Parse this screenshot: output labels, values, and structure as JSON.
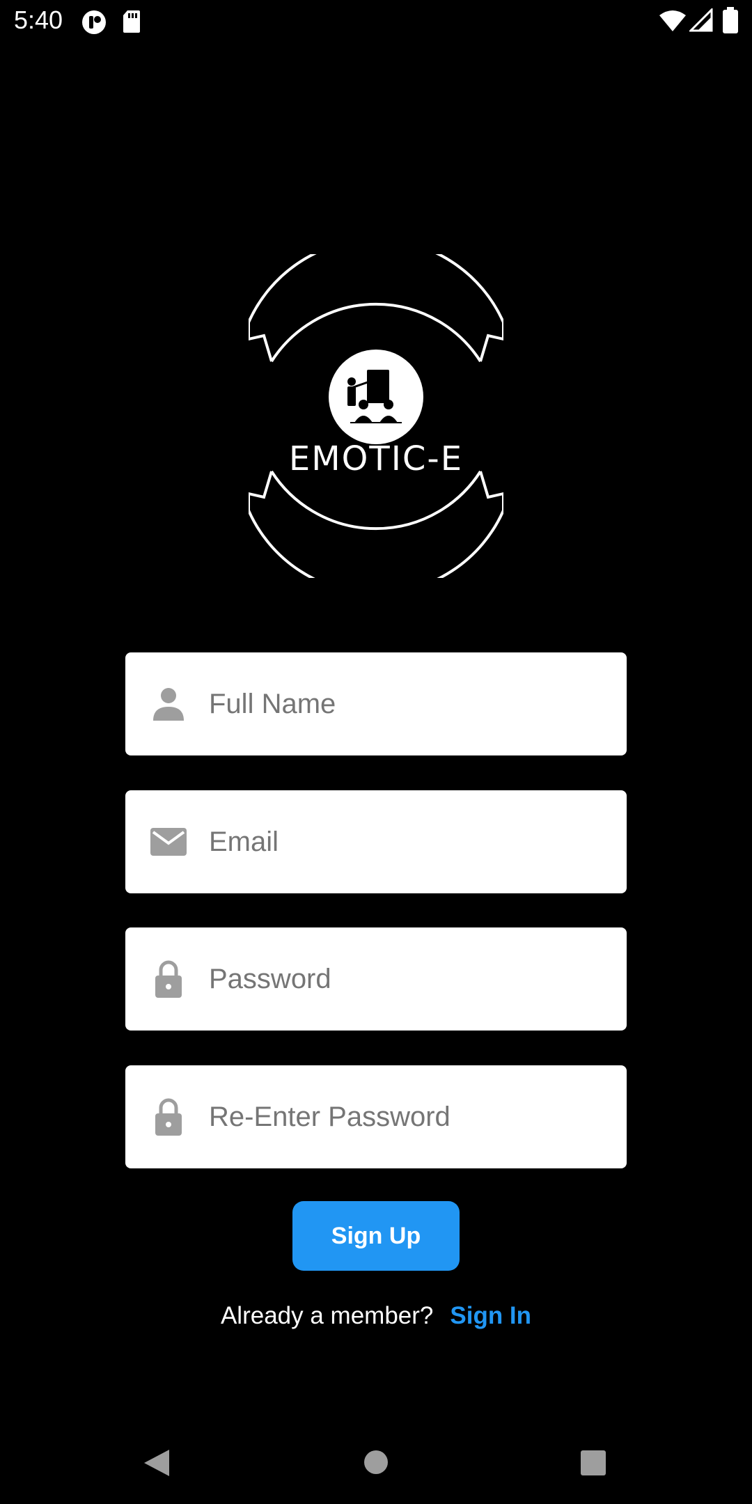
{
  "status_bar": {
    "time": "5:40",
    "icons": [
      "app-notification-icon",
      "sd-card-icon",
      "wifi-icon",
      "cellular-signal-icon",
      "battery-icon"
    ]
  },
  "logo": {
    "text": "EMOTIC-E",
    "icon": "teacher-classroom-icon"
  },
  "form": {
    "full_name": {
      "placeholder": "Full Name",
      "value": "",
      "icon": "person-icon"
    },
    "email": {
      "placeholder": "Email",
      "value": "",
      "icon": "mail-icon"
    },
    "password": {
      "placeholder": "Password",
      "value": "",
      "icon": "lock-icon"
    },
    "re_password": {
      "placeholder": "Re-Enter Password",
      "value": "",
      "icon": "lock-icon"
    }
  },
  "signup_button": {
    "label": "Sign Up"
  },
  "signin": {
    "prompt": "Already a member?",
    "link": "Sign In"
  },
  "nav_bar": {
    "buttons": [
      "back-icon",
      "home-icon",
      "recents-icon"
    ]
  },
  "colors": {
    "background": "#000000",
    "accent": "#2196f3",
    "field_bg": "#ffffff",
    "icon_gray": "#9e9e9e",
    "placeholder": "#757575"
  }
}
